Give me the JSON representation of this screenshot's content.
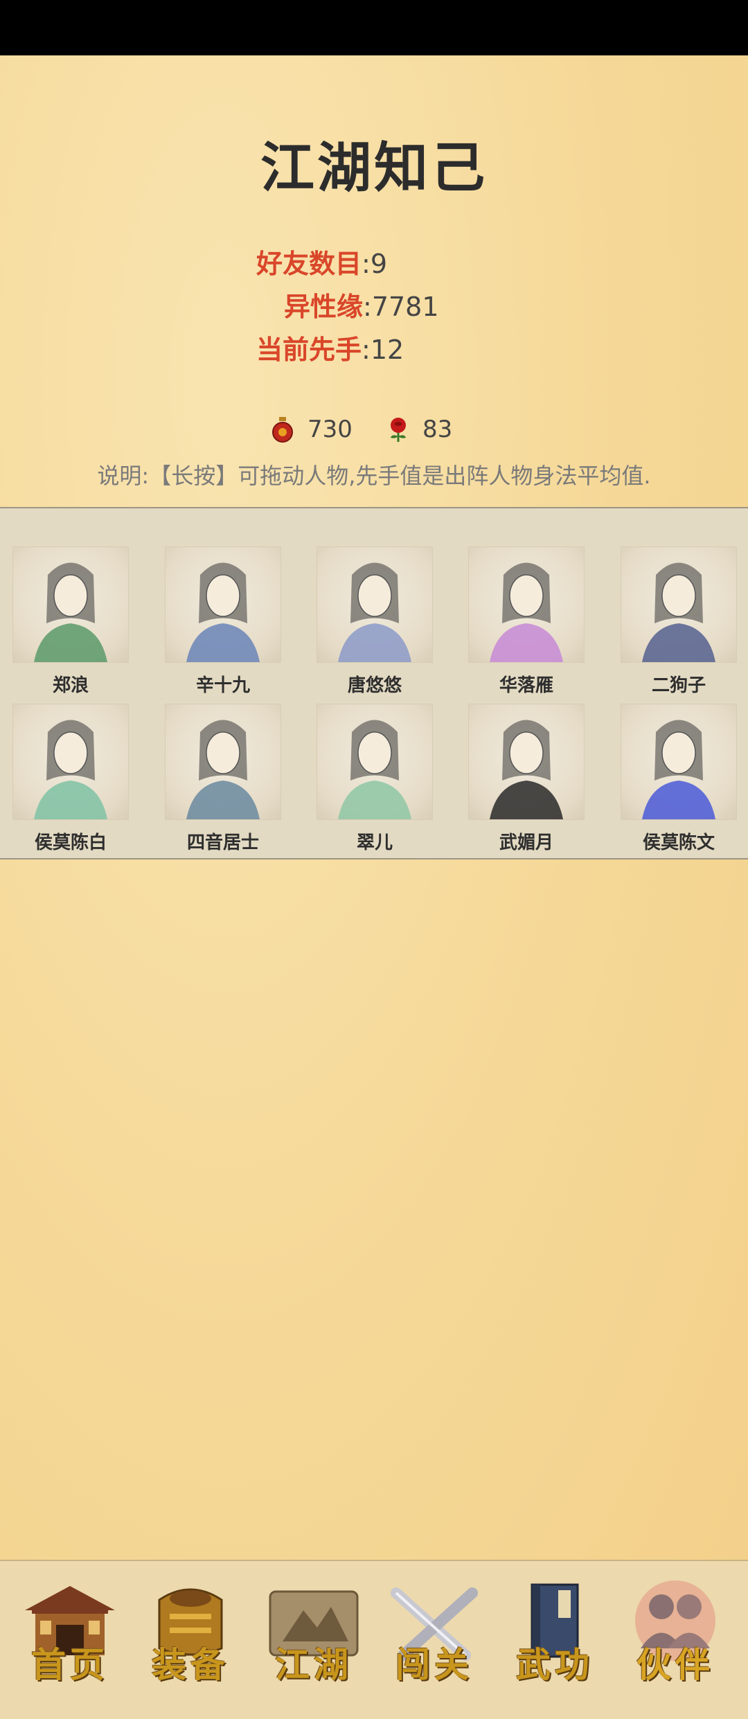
{
  "page": {
    "title": "江湖知己"
  },
  "stats": [
    {
      "label": "好友数目",
      "value": "9"
    },
    {
      "label": "异性缘",
      "value": "7781"
    },
    {
      "label": "当前先手",
      "value": "12"
    }
  ],
  "currency": [
    {
      "icon": "gourd-icon",
      "value": "730"
    },
    {
      "icon": "rose-icon",
      "value": "83"
    }
  ],
  "note": "说明:【长按】可拖动人物,先手值是出阵人物身法平均值.",
  "partners": [
    {
      "name": "郑浪",
      "accent": "#5a9a6a"
    },
    {
      "name": "辛十九",
      "accent": "#6a85b8"
    },
    {
      "name": "唐悠悠",
      "accent": "#8c9ac9"
    },
    {
      "name": "华落雁",
      "accent": "#c78ad6"
    },
    {
      "name": "二狗子",
      "accent": "#55608f"
    },
    {
      "name": "侯莫陈白",
      "accent": "#7fc2a5"
    },
    {
      "name": "四音居士",
      "accent": "#6a8aa0"
    },
    {
      "name": "翠儿",
      "accent": "#8ec7a5"
    },
    {
      "name": "武媚月",
      "accent": "#2a2a2a"
    },
    {
      "name": "侯莫陈文",
      "accent": "#4a5ad8"
    }
  ],
  "nav": [
    {
      "label": "首页",
      "icon": "house-icon"
    },
    {
      "label": "装备",
      "icon": "armor-icon"
    },
    {
      "label": "江湖",
      "icon": "map-scroll-icon"
    },
    {
      "label": "闯关",
      "icon": "crossed-swords-icon"
    },
    {
      "label": "武功",
      "icon": "book-icon"
    },
    {
      "label": "伙伴",
      "icon": "partners-icon",
      "active": true
    }
  ]
}
